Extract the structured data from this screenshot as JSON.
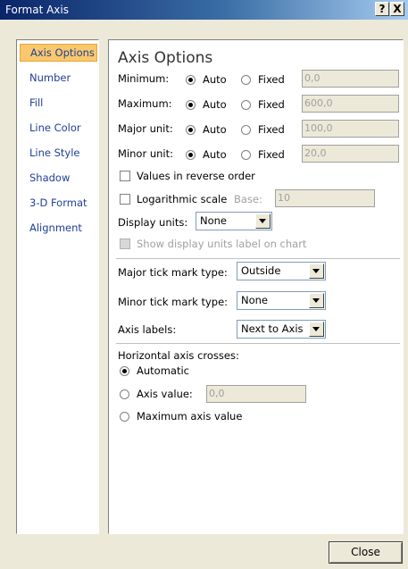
{
  "window": {
    "title": "Format Axis",
    "help_label": "?",
    "close_label": "X"
  },
  "nav": {
    "items": [
      "Axis Options",
      "Number",
      "Fill",
      "Line Color",
      "Line Style",
      "Shadow",
      "3-D Format",
      "Alignment"
    ],
    "selected": "Axis Options"
  },
  "panel": {
    "title": "Axis Options",
    "rows": [
      {
        "label": "Minimum:",
        "auto": "Auto",
        "fixed": "Fixed",
        "value": "0,0"
      },
      {
        "label": "Maximum:",
        "auto": "Auto",
        "fixed": "Fixed",
        "value": "600,0"
      },
      {
        "label": "Major unit:",
        "auto": "Auto",
        "fixed": "Fixed",
        "value": "100,0"
      },
      {
        "label": "Minor unit:",
        "auto": "Auto",
        "fixed": "Fixed",
        "value": "20,0"
      }
    ],
    "reverse_order": "Values in reverse order",
    "log_scale": "Logarithmic scale",
    "base_label": "Base:",
    "base_value": "10",
    "display_units_label": "Display units:",
    "display_units_value": "None",
    "show_units_label": "Show display units label on chart",
    "major_tick_label": "Major tick mark type:",
    "major_tick_value": "Outside",
    "minor_tick_label": "Minor tick mark type:",
    "minor_tick_value": "None",
    "axis_labels_label": "Axis labels:",
    "axis_labels_value": "Next to Axis",
    "crosses_title": "Horizontal axis crosses:",
    "automatic": "Automatic",
    "axis_value_label": "Axis value:",
    "axis_value": "0,0",
    "max_axis_value": "Maximum axis value"
  },
  "footer": {
    "close": "Close"
  },
  "colors": {
    "nav_selected": "#fac86c",
    "nav_text": "#1f3f99",
    "dialog_bg": "#ece9d8"
  }
}
